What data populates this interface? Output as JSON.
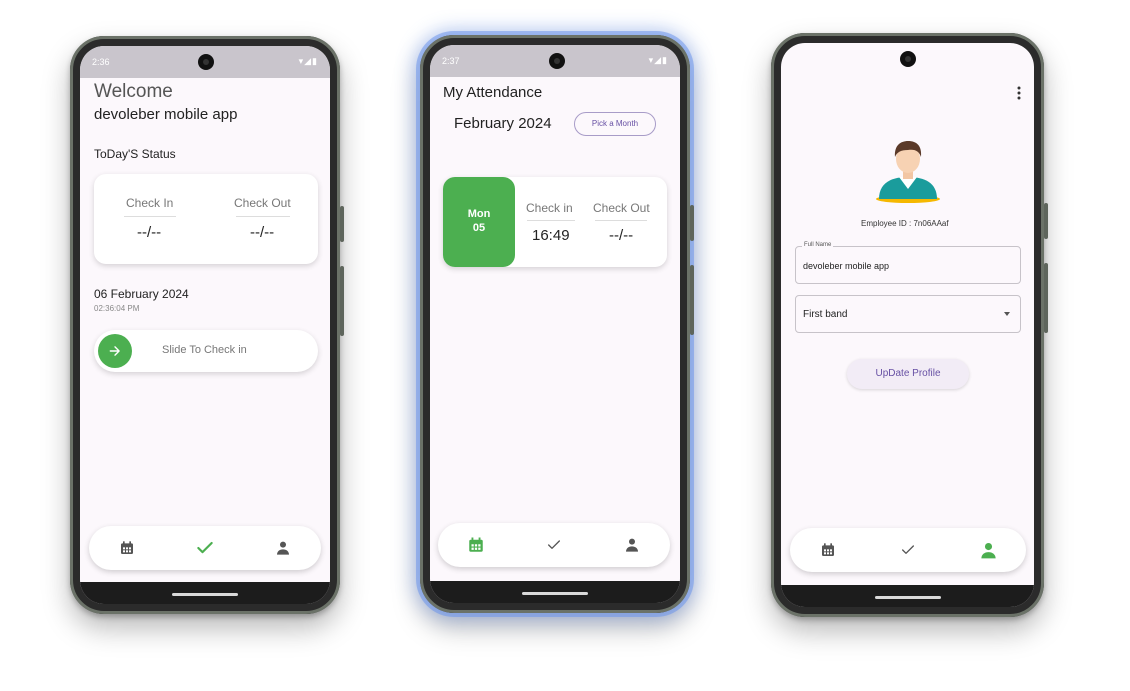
{
  "theme": {
    "accent": "#4caf50",
    "purple": "#6750a4",
    "status_bar": "#c9c5cc",
    "screen_bg": "#fcf8fc"
  },
  "phone1": {
    "status_time": "2:36",
    "title": "Welcome",
    "subtitle": "devoleber mobile app",
    "section_label": "ToDay'S Status",
    "check_in_label": "Check In",
    "check_in_value": "--/--",
    "check_out_label": "Check Out",
    "check_out_value": "--/--",
    "date": "06 February 2024",
    "time": "02:36:04 PM",
    "slider_label": "Slide To Check in",
    "slider_icon": "arrow-right-icon",
    "nav": {
      "active": "check",
      "items": [
        "calendar-icon",
        "check-icon",
        "person-icon"
      ]
    }
  },
  "phone2": {
    "status_time": "2:37",
    "title": "My Attendance",
    "month": "February 2024",
    "pick_month_label": "Pick a Month",
    "records": [
      {
        "day": "Mon",
        "date": "05",
        "check_in_label": "Check in",
        "check_in_value": "16:49",
        "check_out_label": "Check Out",
        "check_out_value": "--/--"
      }
    ],
    "nav": {
      "active": "calendar",
      "items": [
        "calendar-icon",
        "check-icon",
        "person-icon"
      ]
    }
  },
  "phone3": {
    "menu_icon": "more-vert-icon",
    "avatar_icon": "employee-avatar-icon",
    "employee_id": "Employee ID : 7n06AAaf",
    "full_name_label": "Full Name",
    "full_name_value": "devoleber mobile app",
    "band_value": "First band",
    "update_button": "UpDate Profile",
    "nav": {
      "active": "person",
      "items": [
        "calendar-icon",
        "check-icon",
        "person-icon"
      ]
    }
  }
}
